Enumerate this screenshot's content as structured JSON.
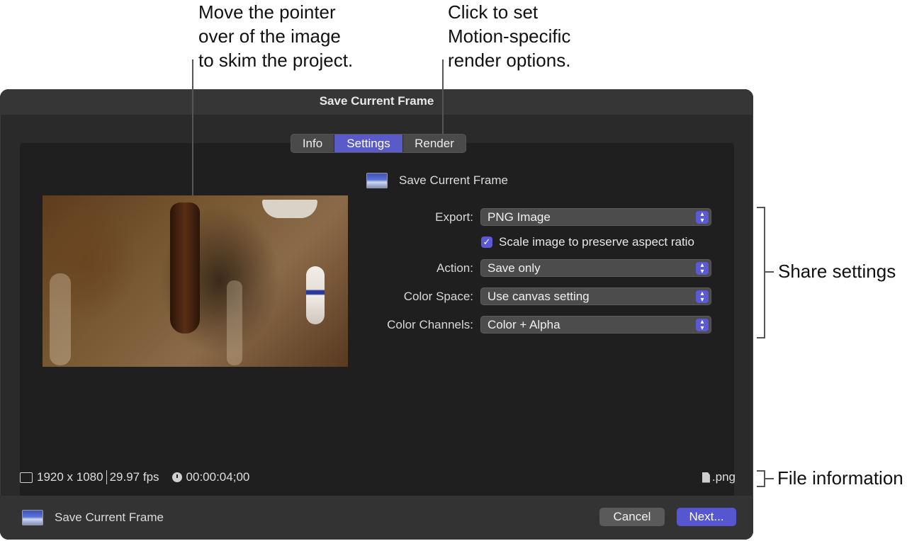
{
  "callouts": {
    "skim": [
      "Move the pointer",
      "over of the image",
      "to skim the project."
    ],
    "render": [
      "Click to set",
      "Motion-specific",
      "render options."
    ],
    "share": "Share settings",
    "file": "File information"
  },
  "dialog": {
    "title": "Save Current Frame",
    "tabs": [
      {
        "label": "Info",
        "active": false
      },
      {
        "label": "Settings",
        "active": true
      },
      {
        "label": "Render",
        "active": false
      }
    ],
    "settings_header": "Save Current Frame",
    "export": {
      "label": "Export:",
      "value": "PNG Image"
    },
    "scale_checkbox": {
      "label": "Scale image to preserve aspect ratio",
      "checked": true
    },
    "action": {
      "label": "Action:",
      "value": "Save only"
    },
    "color_space": {
      "label": "Color Space:",
      "value": "Use canvas setting"
    },
    "color_channels": {
      "label": "Color Channels:",
      "value": "Color + Alpha"
    },
    "info": {
      "resolution": "1920 x 1080",
      "fps": "29.97 fps",
      "duration": "00:00:04;00",
      "extension": ".png"
    },
    "footer": {
      "title": "Save Current Frame",
      "cancel": "Cancel",
      "next": "Next..."
    }
  },
  "colors": {
    "accent": "#5a5ad6",
    "background": "#2a2a2a"
  },
  "icons": [
    "frame-thumbnail-icon",
    "checkmark-icon",
    "popup-stepper-icon",
    "resolution-icon",
    "clock-icon",
    "file-icon"
  ]
}
